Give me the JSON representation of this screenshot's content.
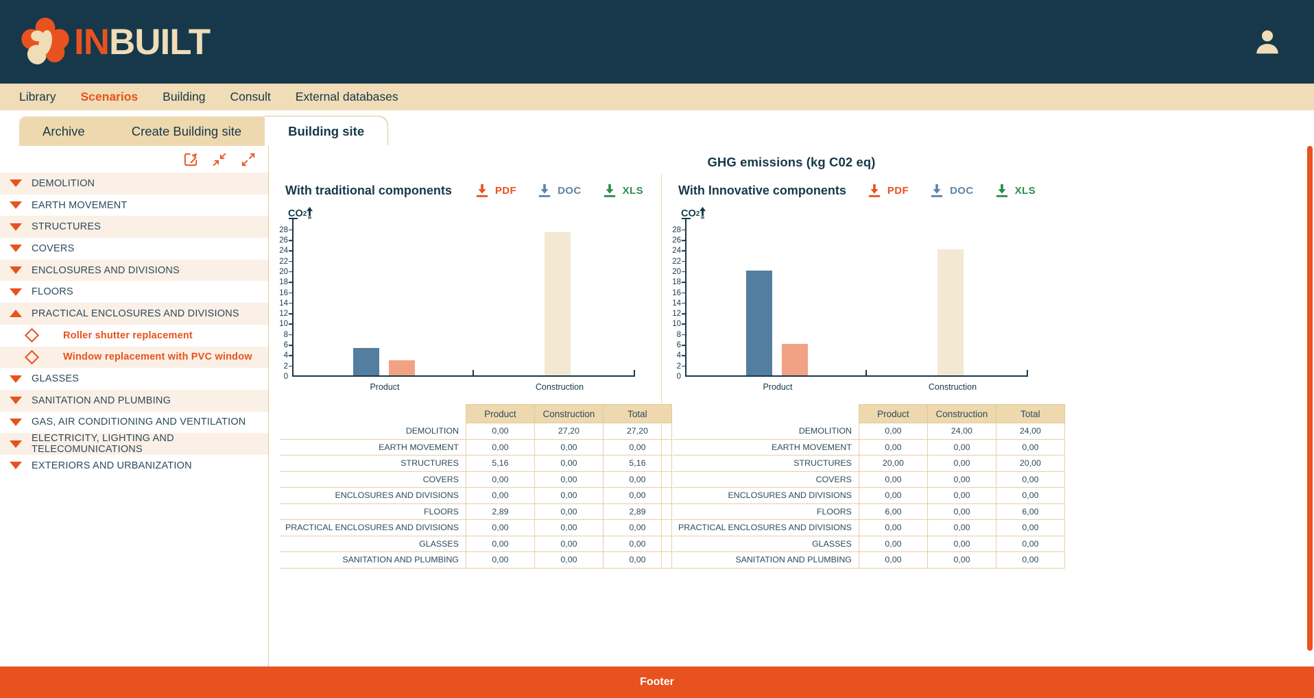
{
  "brand": {
    "in": "IN",
    "built": "BUILT",
    "logo_icon": "flower-logo-icon",
    "avatar_icon": "user-avatar-icon"
  },
  "colors": {
    "navy": "#16384a",
    "orange": "#e8521f",
    "cream": "#f0dcb6",
    "bar_blue": "#547e9f",
    "bar_salmon": "#f1a285",
    "bar_cream": "#f3e8d2",
    "pdf": "#e8521f",
    "doc": "#5b84a8",
    "xls": "#2e8b4f"
  },
  "menu": {
    "items": [
      {
        "label": "Library",
        "active": false
      },
      {
        "label": "Scenarios",
        "active": true
      },
      {
        "label": "Building",
        "active": false
      },
      {
        "label": "Consult",
        "active": false
      },
      {
        "label": "External databases",
        "active": false
      }
    ]
  },
  "tabs": [
    {
      "label": "Archive",
      "active": false
    },
    {
      "label": "Create Building site",
      "active": false
    },
    {
      "label": "Building site",
      "active": true
    }
  ],
  "sidebar": {
    "tools": [
      {
        "name": "edit-icon"
      },
      {
        "name": "collapse-all-icon"
      },
      {
        "name": "expand-all-icon"
      }
    ],
    "items": [
      {
        "label": "DEMOLITION",
        "expanded": false,
        "type": "group"
      },
      {
        "label": "EARTH MOVEMENT",
        "expanded": false,
        "type": "group"
      },
      {
        "label": "STRUCTURES",
        "expanded": false,
        "type": "group"
      },
      {
        "label": "COVERS",
        "expanded": false,
        "type": "group"
      },
      {
        "label": "ENCLOSURES AND DIVISIONS",
        "expanded": false,
        "type": "group"
      },
      {
        "label": "FLOORS",
        "expanded": false,
        "type": "group"
      },
      {
        "label": "PRACTICAL ENCLOSURES AND DIVISIONS",
        "expanded": true,
        "type": "group"
      },
      {
        "label": "Roller shutter replacement",
        "type": "child"
      },
      {
        "label": "Window replacement with PVC window",
        "type": "child"
      },
      {
        "label": "GLASSES",
        "expanded": false,
        "type": "group"
      },
      {
        "label": "SANITATION AND PLUMBING",
        "expanded": false,
        "type": "group"
      },
      {
        "label": "GAS, AIR CONDITIONING AND VENTILATION",
        "expanded": false,
        "type": "group"
      },
      {
        "label": "ELECTRICITY, LIGHTING AND TELECOMUNICATIONS",
        "expanded": false,
        "type": "group"
      },
      {
        "label": "EXTERIORS AND URBANIZATION",
        "expanded": false,
        "type": "group"
      }
    ]
  },
  "main": {
    "title": "GHG emissions (kg C02 eq)",
    "export_labels": {
      "pdf": "PDF",
      "doc": "DOC",
      "xls": "XLS"
    },
    "panels": [
      {
        "title": "With traditional components"
      },
      {
        "title": "With Innovative components"
      }
    ]
  },
  "footer": {
    "label": "Footer"
  },
  "chart_data": [
    {
      "type": "bar",
      "title": "With traditional components",
      "ylabel": "CO2",
      "xlabel": "",
      "categories": [
        "Product",
        "Construction"
      ],
      "ylim": [
        0,
        29
      ],
      "yticks": [
        0,
        2,
        4,
        6,
        8,
        10,
        12,
        14,
        16,
        18,
        20,
        22,
        24,
        26,
        28
      ],
      "grid": false,
      "legend": "none",
      "bars": [
        {
          "group": "Product",
          "series": "STRUCTURES",
          "value": 5.16,
          "color": "#547e9f"
        },
        {
          "group": "Product",
          "series": "FLOORS",
          "value": 2.89,
          "color": "#f1a285"
        },
        {
          "group": "Construction",
          "series": "DEMOLITION",
          "value": 27.2,
          "color": "#f3e8d2"
        }
      ]
    },
    {
      "type": "bar",
      "title": "With Innovative components",
      "ylabel": "CO2",
      "xlabel": "",
      "categories": [
        "Product",
        "Construction"
      ],
      "ylim": [
        0,
        29
      ],
      "yticks": [
        0,
        2,
        4,
        6,
        8,
        10,
        12,
        14,
        16,
        18,
        20,
        22,
        24,
        26,
        28
      ],
      "grid": false,
      "legend": "none",
      "bars": [
        {
          "group": "Product",
          "series": "STRUCTURES",
          "value": 20.0,
          "color": "#547e9f"
        },
        {
          "group": "Product",
          "series": "FLOORS",
          "value": 6.0,
          "color": "#f1a285"
        },
        {
          "group": "Construction",
          "series": "DEMOLITION",
          "value": 24.0,
          "color": "#f3e8d2"
        }
      ]
    }
  ],
  "tables": [
    {
      "headers": [
        "",
        "Product",
        "Construction",
        "Total"
      ],
      "rows": [
        {
          "name": "DEMOLITION",
          "product": "0,00",
          "construction": "27,20",
          "total": "27,20"
        },
        {
          "name": "EARTH MOVEMENT",
          "product": "0,00",
          "construction": "0,00",
          "total": "0,00"
        },
        {
          "name": "STRUCTURES",
          "product": "5,16",
          "construction": "0,00",
          "total": "5,16"
        },
        {
          "name": "COVERS",
          "product": "0,00",
          "construction": "0,00",
          "total": "0,00"
        },
        {
          "name": "ENCLOSURES AND DIVISIONS",
          "product": "0,00",
          "construction": "0,00",
          "total": "0,00"
        },
        {
          "name": "FLOORS",
          "product": "2,89",
          "construction": "0,00",
          "total": "2,89"
        },
        {
          "name": "PRACTICAL ENCLOSURES AND DIVISIONS",
          "product": "0,00",
          "construction": "0,00",
          "total": "0,00"
        },
        {
          "name": "GLASSES",
          "product": "0,00",
          "construction": "0,00",
          "total": "0,00"
        },
        {
          "name": "SANITATION AND PLUMBING",
          "product": "0,00",
          "construction": "0,00",
          "total": "0,00"
        }
      ]
    },
    {
      "headers": [
        "",
        "Product",
        "Construction",
        "Total"
      ],
      "rows": [
        {
          "name": "DEMOLITION",
          "product": "0,00",
          "construction": "24,00",
          "total": "24,00"
        },
        {
          "name": "EARTH MOVEMENT",
          "product": "0,00",
          "construction": "0,00",
          "total": "0,00"
        },
        {
          "name": "STRUCTURES",
          "product": "20,00",
          "construction": "0,00",
          "total": "20,00"
        },
        {
          "name": "COVERS",
          "product": "0,00",
          "construction": "0,00",
          "total": "0,00"
        },
        {
          "name": "ENCLOSURES AND DIVISIONS",
          "product": "0,00",
          "construction": "0,00",
          "total": "0,00"
        },
        {
          "name": "FLOORS",
          "product": "6,00",
          "construction": "0,00",
          "total": "6,00"
        },
        {
          "name": "PRACTICAL ENCLOSURES AND DIVISIONS",
          "product": "0,00",
          "construction": "0,00",
          "total": "0,00"
        },
        {
          "name": "GLASSES",
          "product": "0,00",
          "construction": "0,00",
          "total": "0,00"
        },
        {
          "name": "SANITATION AND PLUMBING",
          "product": "0,00",
          "construction": "0,00",
          "total": "0,00"
        }
      ]
    }
  ]
}
